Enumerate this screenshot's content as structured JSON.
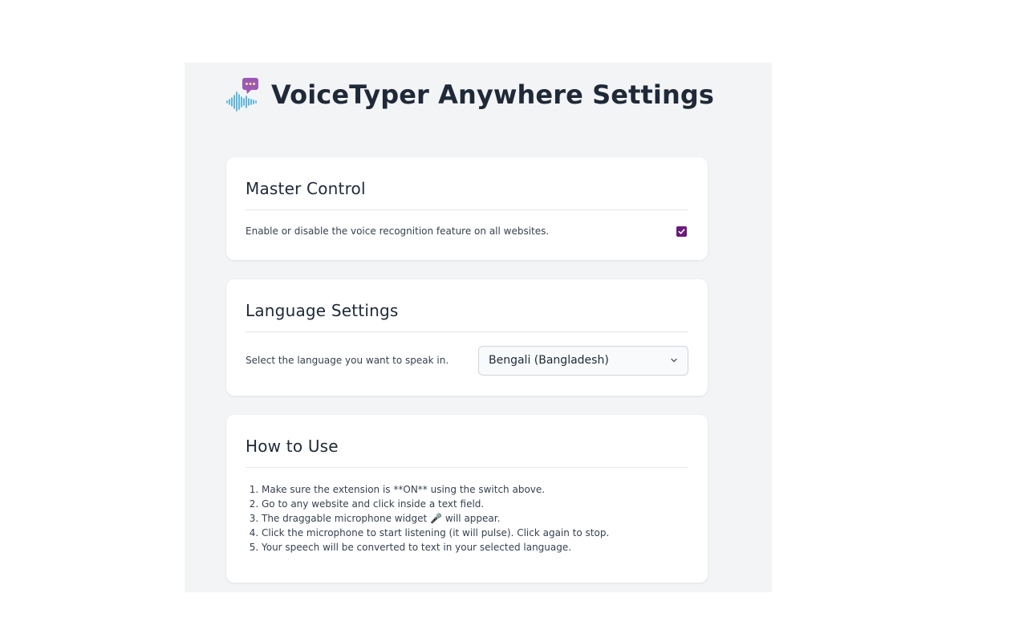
{
  "header": {
    "title": "VoiceTyper Anywhere Settings",
    "logo_icon": "voice-chat-logo"
  },
  "master_control": {
    "title": "Master Control",
    "description": "Enable or disable the voice recognition feature on all websites.",
    "enabled": true
  },
  "language_settings": {
    "title": "Language Settings",
    "description": "Select the language you want to speak in.",
    "selected_language": "Bengali (Bangladesh)"
  },
  "how_to_use": {
    "title": "How to Use",
    "steps": [
      "Make sure the extension is **ON** using the switch above.",
      "Go to any website and click inside a text field.",
      "The draggable microphone widget 🎤 will appear.",
      "Click the microphone to start listening (it will pulse). Click again to stop.",
      "Your speech will be converted to text in your selected language."
    ]
  },
  "colors": {
    "page_bg": "#f3f4f6",
    "card_bg": "#ffffff",
    "accent_purple": "#6b1a7a",
    "logo_purple": "#9b59b6",
    "wave_blue": "#3ba7d6"
  }
}
